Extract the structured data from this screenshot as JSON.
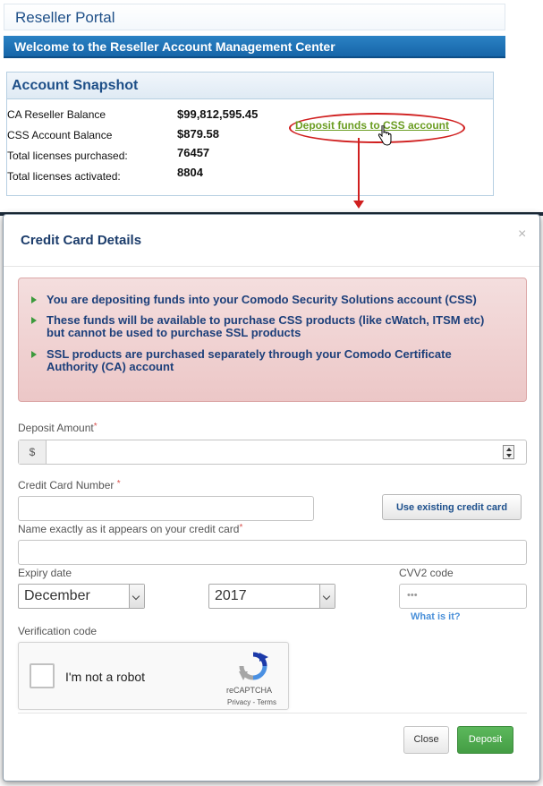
{
  "portal": {
    "title": "Reseller Portal",
    "welcome": "Welcome to the Reseller Account Management Center"
  },
  "snapshot": {
    "heading": "Account Snapshot",
    "rows": [
      {
        "label": "CA Reseller Balance",
        "value": "$99,812,595.45"
      },
      {
        "label": "CSS Account Balance",
        "value": "$879.58"
      },
      {
        "label": "Total licenses purchased:",
        "value": "76457"
      },
      {
        "label": "Total licenses activated:",
        "value": "8804"
      }
    ],
    "deposit_link": "Deposit funds to CSS account"
  },
  "modal": {
    "title": "Credit Card Details",
    "close_glyph": "×",
    "alerts": [
      "You are depositing funds into your Comodo Security Solutions account (CSS)",
      "These funds will be available to purchase CSS products (like cWatch, ITSM etc) but cannot be used to purchase SSL products",
      "SSL products are purchased separately through your Comodo Certificate Authority (CA) account"
    ],
    "form": {
      "deposit_amount_label": "Deposit Amount",
      "currency_symbol": "$",
      "deposit_amount_value": "",
      "card_number_label": "Credit Card Number",
      "card_number_value": "",
      "use_existing_button": "Use existing credit card",
      "name_label": "Name exactly as it appears on your credit card",
      "name_value": "",
      "expiry_label": "Expiry date",
      "expiry_month": "December",
      "expiry_year": "2017",
      "cvv_label": "CVV2 code",
      "cvv_placeholder": "•••",
      "what_is_it": "What is it?",
      "verification_label": "Verification code",
      "required_mark": "*"
    },
    "recaptcha": {
      "label": "I'm not a robot",
      "brand": "reCAPTCHA",
      "links": "Privacy - Terms"
    },
    "buttons": {
      "close": "Close",
      "deposit": "Deposit"
    }
  },
  "colors": {
    "portal_blue": "#1e4f88",
    "welcome_bar": "#1665a8",
    "alert_bg": "#f0d3d3",
    "alert_text": "#1c3f7a",
    "link_green": "#6b9d22",
    "highlight_red": "#d01f1f",
    "deposit_green": "#5cb85c"
  }
}
